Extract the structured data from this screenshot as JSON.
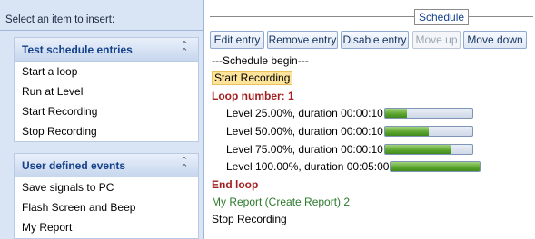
{
  "left_panel": {
    "insert_label": "Select an item to insert:",
    "groups": [
      {
        "title": "Test schedule entries",
        "collapse_icon": "double-chevron-up-icon",
        "items": [
          "Start a loop",
          "Run at Level",
          "Start Recording",
          "Stop Recording"
        ]
      },
      {
        "title": "User defined events",
        "collapse_icon": "double-chevron-up-icon",
        "items": [
          "Save signals to PC",
          "Flash Screen and Beep",
          "My Report"
        ]
      }
    ]
  },
  "schedule": {
    "title": "Schedule",
    "toolbar": {
      "edit": "Edit entry",
      "remove": "Remove entry",
      "disable": "Disable entry",
      "move_up": "Move up",
      "move_down": "Move down"
    },
    "entries": {
      "begin": "---Schedule begin---",
      "start_recording": "Start Recording",
      "loop": "Loop number: 1",
      "levels": [
        {
          "text": "Level 25.00%, duration 00:00:10",
          "progress": 0.25
        },
        {
          "text": "Level 50.00%, duration 00:00:10",
          "progress": 0.5
        },
        {
          "text": "Level 75.00%, duration 00:00:10",
          "progress": 0.75
        },
        {
          "text": "Level 100.00%, duration 00:05:00",
          "progress": 1.0
        }
      ],
      "end_loop": "End loop",
      "report": "My Report (Create Report) 2",
      "stop_recording": "Stop Recording"
    },
    "colors": {
      "loop": "#a41f1f",
      "report": "#2c7a2c",
      "highlight": "#fde49a",
      "progress_fill": "#5aa32e"
    }
  }
}
